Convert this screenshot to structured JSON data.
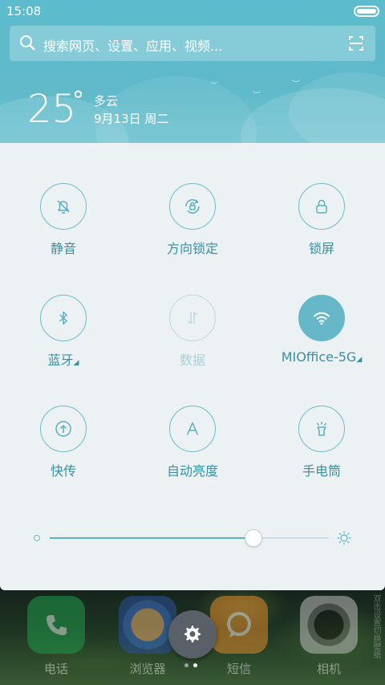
{
  "statusbar": {
    "time": "15:08"
  },
  "search": {
    "placeholder": "搜索网页、设置、应用、视频..."
  },
  "weather": {
    "temperature": "25",
    "degree": "°",
    "condition": "多云",
    "date": "9月13日 周二"
  },
  "tiles": [
    {
      "label": "静音",
      "state": "off"
    },
    {
      "label": "方向锁定",
      "state": "off"
    },
    {
      "label": "锁屏",
      "state": "off"
    },
    {
      "label": "蓝牙",
      "state": "off",
      "expandable": true
    },
    {
      "label": "数据",
      "state": "disabled"
    },
    {
      "label": "MIOffice-5G",
      "state": "on",
      "expandable": true
    },
    {
      "label": "快传",
      "state": "off"
    },
    {
      "label": "自动亮度",
      "state": "off"
    },
    {
      "label": "手电筒",
      "state": "off"
    }
  ],
  "brightness": {
    "level": 0.73
  },
  "dock": {
    "apps": [
      "电话",
      "浏览器",
      "短信",
      "相机"
    ],
    "side_text": "双击设置切换壁纸"
  },
  "colors": {
    "accent": "#66b8c8",
    "header": "#5cbccd",
    "panel": "#ecf2f4"
  }
}
